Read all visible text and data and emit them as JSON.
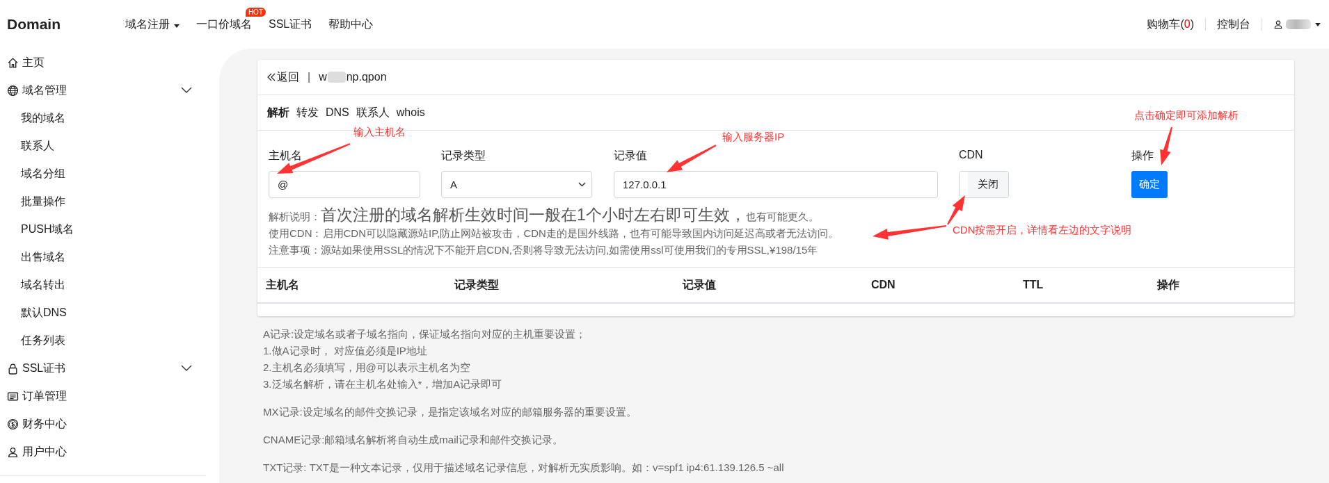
{
  "header": {
    "logo": "Domain",
    "nav": [
      {
        "label": "域名注册",
        "dropdown": true
      },
      {
        "label": "一口价域名",
        "dropdown": false,
        "badge": "HOT"
      },
      {
        "label": "SSL证书",
        "dropdown": false
      },
      {
        "label": "帮助中心",
        "dropdown": false
      }
    ],
    "cart": {
      "label": "购物车(",
      "count": "0",
      "close": ")"
    },
    "console": "控制台"
  },
  "sidebar": {
    "items": [
      {
        "label": "主页",
        "kind": "link"
      },
      {
        "label": "域名管理",
        "kind": "group",
        "expanded": true,
        "children": [
          {
            "label": "我的域名"
          },
          {
            "label": "联系人"
          },
          {
            "label": "域名分组"
          },
          {
            "label": "批量操作"
          },
          {
            "label": "PUSH域名"
          },
          {
            "label": "出售域名"
          },
          {
            "label": "域名转出"
          },
          {
            "label": "默认DNS"
          },
          {
            "label": "任务列表"
          }
        ]
      },
      {
        "label": "SSL证书",
        "kind": "group"
      },
      {
        "label": "订单管理",
        "kind": "link"
      },
      {
        "label": "财务中心",
        "kind": "link"
      },
      {
        "label": "用户中心",
        "kind": "link"
      }
    ]
  },
  "card": {
    "back": "返回",
    "separator": "|",
    "domain_start": "w",
    "domain_end": "np.qpon",
    "tabs": [
      {
        "label": "解析",
        "selected": true
      },
      {
        "label": "转发",
        "selected": false
      },
      {
        "label": "DNS",
        "selected": false
      },
      {
        "label": "联系人",
        "selected": false
      },
      {
        "label": "whois",
        "selected": false
      }
    ],
    "form": {
      "host": {
        "label": "主机名",
        "value": "@"
      },
      "type": {
        "label": "记录类型",
        "value": "A"
      },
      "record": {
        "label": "记录值",
        "value": "127.0.0.1"
      },
      "cdn": {
        "label": "CDN",
        "toggle": "关闭",
        "on": false
      },
      "action": {
        "label": "操作",
        "button": "确定"
      }
    },
    "notes": [
      {
        "label": "解析说明：",
        "main": "首次注册的域名解析生效时间一般在1个小时左右即可生效，",
        "tail": "也有可能更久。"
      },
      {
        "label": "使用CDN：",
        "tail": "启用CDN可以隐藏源站IP,防止网站被攻击，CDN走的是国外线路，也有可能导致国内访问延迟高或者无法访问。"
      },
      {
        "label": "注意事项：",
        "tail": "源站如果使用SSL的情况下不能开启CDN,否则将导致无法访问,如需使用ssl可使用我们的专用SSL,¥198/15年"
      }
    ],
    "table": {
      "columns": [
        "主机名",
        "记录类型",
        "记录值",
        "CDN",
        "TTL",
        "操作"
      ]
    }
  },
  "help": [
    [
      "A记录:设定域名或者子域名指向，保证域名指向对应的主机重要设置；",
      "1.做A记录时， 对应值必须是IP地址",
      "2.主机名必须填写，用@可以表示主机名为空",
      "3.泛域名解析，请在主机名处输入*，增加A记录即可"
    ],
    [
      "MX记录:设定域名的邮件交换记录，是指定该域名对应的邮箱服务器的重要设置。"
    ],
    [
      "CNAME记录:邮箱域名解析将自动生成mail记录和邮件交换记录。"
    ],
    [
      "TXT记录: TXT是一种文本记录，仅用于描述域名记录信息，对解析无实质影响。如：v=spf1 ip4:61.139.126.5 ~all"
    ]
  ],
  "annotations": [
    {
      "text": "输入主机名",
      "kind": "label"
    },
    {
      "text": "输入服务器IP",
      "kind": "label"
    },
    {
      "text": "点击确定即可添加解析",
      "kind": "label"
    },
    {
      "text": "CDN按需开启，详情看左边的文字说明",
      "kind": "label"
    }
  ]
}
